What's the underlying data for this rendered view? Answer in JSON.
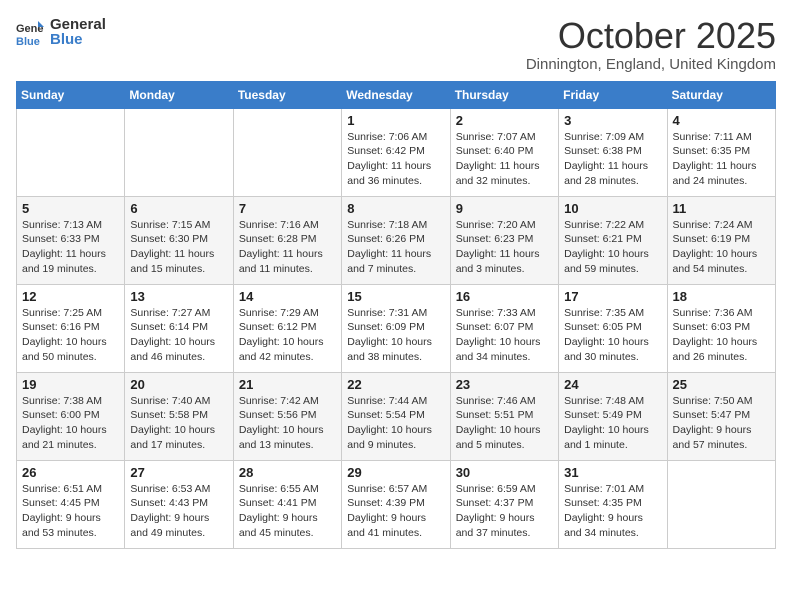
{
  "header": {
    "logo_general": "General",
    "logo_blue": "Blue",
    "title": "October 2025",
    "subtitle": "Dinnington, England, United Kingdom"
  },
  "weekdays": [
    "Sunday",
    "Monday",
    "Tuesday",
    "Wednesday",
    "Thursday",
    "Friday",
    "Saturday"
  ],
  "weeks": [
    [
      {
        "day": "",
        "info": ""
      },
      {
        "day": "",
        "info": ""
      },
      {
        "day": "",
        "info": ""
      },
      {
        "day": "1",
        "info": "Sunrise: 7:06 AM\nSunset: 6:42 PM\nDaylight: 11 hours\nand 36 minutes."
      },
      {
        "day": "2",
        "info": "Sunrise: 7:07 AM\nSunset: 6:40 PM\nDaylight: 11 hours\nand 32 minutes."
      },
      {
        "day": "3",
        "info": "Sunrise: 7:09 AM\nSunset: 6:38 PM\nDaylight: 11 hours\nand 28 minutes."
      },
      {
        "day": "4",
        "info": "Sunrise: 7:11 AM\nSunset: 6:35 PM\nDaylight: 11 hours\nand 24 minutes."
      }
    ],
    [
      {
        "day": "5",
        "info": "Sunrise: 7:13 AM\nSunset: 6:33 PM\nDaylight: 11 hours\nand 19 minutes."
      },
      {
        "day": "6",
        "info": "Sunrise: 7:15 AM\nSunset: 6:30 PM\nDaylight: 11 hours\nand 15 minutes."
      },
      {
        "day": "7",
        "info": "Sunrise: 7:16 AM\nSunset: 6:28 PM\nDaylight: 11 hours\nand 11 minutes."
      },
      {
        "day": "8",
        "info": "Sunrise: 7:18 AM\nSunset: 6:26 PM\nDaylight: 11 hours\nand 7 minutes."
      },
      {
        "day": "9",
        "info": "Sunrise: 7:20 AM\nSunset: 6:23 PM\nDaylight: 11 hours\nand 3 minutes."
      },
      {
        "day": "10",
        "info": "Sunrise: 7:22 AM\nSunset: 6:21 PM\nDaylight: 10 hours\nand 59 minutes."
      },
      {
        "day": "11",
        "info": "Sunrise: 7:24 AM\nSunset: 6:19 PM\nDaylight: 10 hours\nand 54 minutes."
      }
    ],
    [
      {
        "day": "12",
        "info": "Sunrise: 7:25 AM\nSunset: 6:16 PM\nDaylight: 10 hours\nand 50 minutes."
      },
      {
        "day": "13",
        "info": "Sunrise: 7:27 AM\nSunset: 6:14 PM\nDaylight: 10 hours\nand 46 minutes."
      },
      {
        "day": "14",
        "info": "Sunrise: 7:29 AM\nSunset: 6:12 PM\nDaylight: 10 hours\nand 42 minutes."
      },
      {
        "day": "15",
        "info": "Sunrise: 7:31 AM\nSunset: 6:09 PM\nDaylight: 10 hours\nand 38 minutes."
      },
      {
        "day": "16",
        "info": "Sunrise: 7:33 AM\nSunset: 6:07 PM\nDaylight: 10 hours\nand 34 minutes."
      },
      {
        "day": "17",
        "info": "Sunrise: 7:35 AM\nSunset: 6:05 PM\nDaylight: 10 hours\nand 30 minutes."
      },
      {
        "day": "18",
        "info": "Sunrise: 7:36 AM\nSunset: 6:03 PM\nDaylight: 10 hours\nand 26 minutes."
      }
    ],
    [
      {
        "day": "19",
        "info": "Sunrise: 7:38 AM\nSunset: 6:00 PM\nDaylight: 10 hours\nand 21 minutes."
      },
      {
        "day": "20",
        "info": "Sunrise: 7:40 AM\nSunset: 5:58 PM\nDaylight: 10 hours\nand 17 minutes."
      },
      {
        "day": "21",
        "info": "Sunrise: 7:42 AM\nSunset: 5:56 PM\nDaylight: 10 hours\nand 13 minutes."
      },
      {
        "day": "22",
        "info": "Sunrise: 7:44 AM\nSunset: 5:54 PM\nDaylight: 10 hours\nand 9 minutes."
      },
      {
        "day": "23",
        "info": "Sunrise: 7:46 AM\nSunset: 5:51 PM\nDaylight: 10 hours\nand 5 minutes."
      },
      {
        "day": "24",
        "info": "Sunrise: 7:48 AM\nSunset: 5:49 PM\nDaylight: 10 hours\nand 1 minute."
      },
      {
        "day": "25",
        "info": "Sunrise: 7:50 AM\nSunset: 5:47 PM\nDaylight: 9 hours\nand 57 minutes."
      }
    ],
    [
      {
        "day": "26",
        "info": "Sunrise: 6:51 AM\nSunset: 4:45 PM\nDaylight: 9 hours\nand 53 minutes."
      },
      {
        "day": "27",
        "info": "Sunrise: 6:53 AM\nSunset: 4:43 PM\nDaylight: 9 hours\nand 49 minutes."
      },
      {
        "day": "28",
        "info": "Sunrise: 6:55 AM\nSunset: 4:41 PM\nDaylight: 9 hours\nand 45 minutes."
      },
      {
        "day": "29",
        "info": "Sunrise: 6:57 AM\nSunset: 4:39 PM\nDaylight: 9 hours\nand 41 minutes."
      },
      {
        "day": "30",
        "info": "Sunrise: 6:59 AM\nSunset: 4:37 PM\nDaylight: 9 hours\nand 37 minutes."
      },
      {
        "day": "31",
        "info": "Sunrise: 7:01 AM\nSunset: 4:35 PM\nDaylight: 9 hours\nand 34 minutes."
      },
      {
        "day": "",
        "info": ""
      }
    ]
  ]
}
